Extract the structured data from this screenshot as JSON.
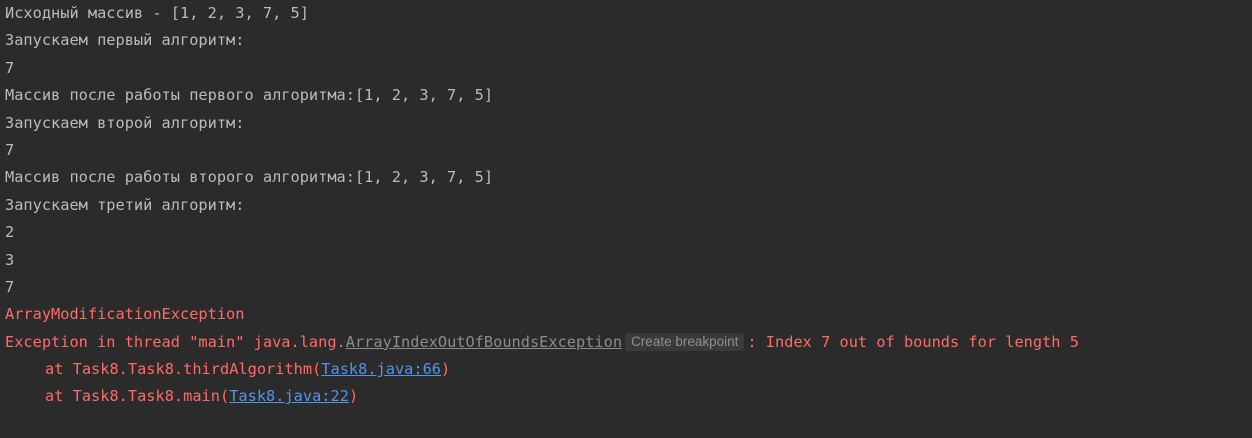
{
  "console": {
    "lines": [
      "Исходный массив - [1, 2, 3, 7, 5]",
      "Запускаем первый алгоритм:",
      "7",
      "Массив после работы первого алгоритма:[1, 2, 3, 7, 5]",
      "Запускаем второй алгоритм:",
      "7",
      "Массив после работы второго алгоритма:[1, 2, 3, 7, 5]",
      "Запускаем третий алгоритм:",
      "2",
      "3",
      "7"
    ],
    "custom_exception": "ArrayModificationException",
    "exception": {
      "prefix": "Exception in thread \"main\" java.lang.",
      "class_name": "ArrayIndexOutOfBoundsException",
      "hint_label": "Create breakpoint",
      "message": ": Index 7 out of bounds for length 5"
    },
    "stack": [
      {
        "prefix": "at Task8.Task8.thirdAlgorithm(",
        "link": "Task8.java:66",
        "suffix": ")"
      },
      {
        "prefix": "at Task8.Task8.main(",
        "link": "Task8.java:22",
        "suffix": ")"
      }
    ]
  },
  "colors": {
    "background": "#2b2b2b",
    "text": "#bbbbbb",
    "error": "#ff6b68",
    "link": "#5394ec"
  }
}
